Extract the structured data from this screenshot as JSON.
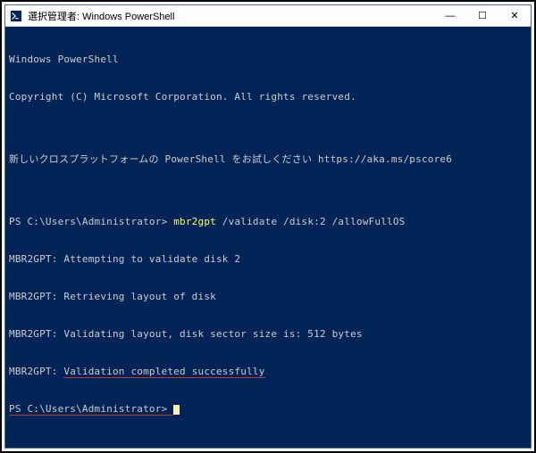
{
  "window": {
    "title": "選択管理者: Windows PowerShell",
    "controls": {
      "minimize": "—",
      "maximize": "☐",
      "close": "✕"
    }
  },
  "terminal": {
    "header1": "Windows PowerShell",
    "header2": "Copyright (C) Microsoft Corporation. All rights reserved.",
    "blank1": "",
    "tryNew": "新しいクロスプラットフォームの PowerShell をお試しください https://aka.ms/pscore6",
    "blank2": "",
    "prompt1_prefix": "PS C:\\Users\\Administrator> ",
    "prompt1_cmd": "mbr2gpt",
    "prompt1_args": " /validate /disk:2 /allowFullOS",
    "out1": "MBR2GPT: Attempting to validate disk 2",
    "out2": "MBR2GPT: Retrieving layout of disk",
    "out3": "MBR2GPT: Validating layout, disk sector size is: 512 bytes",
    "out4_prefix": "MBR2GPT: ",
    "out4_success": "Validation completed successfully",
    "prompt2_prefix": "PS C:\\Users\\Administrator> "
  },
  "colors": {
    "terminal_bg": "#012456",
    "terminal_fg": "#cccccc",
    "cmd_highlight": "#ffff66",
    "underline": "#cc3333"
  }
}
